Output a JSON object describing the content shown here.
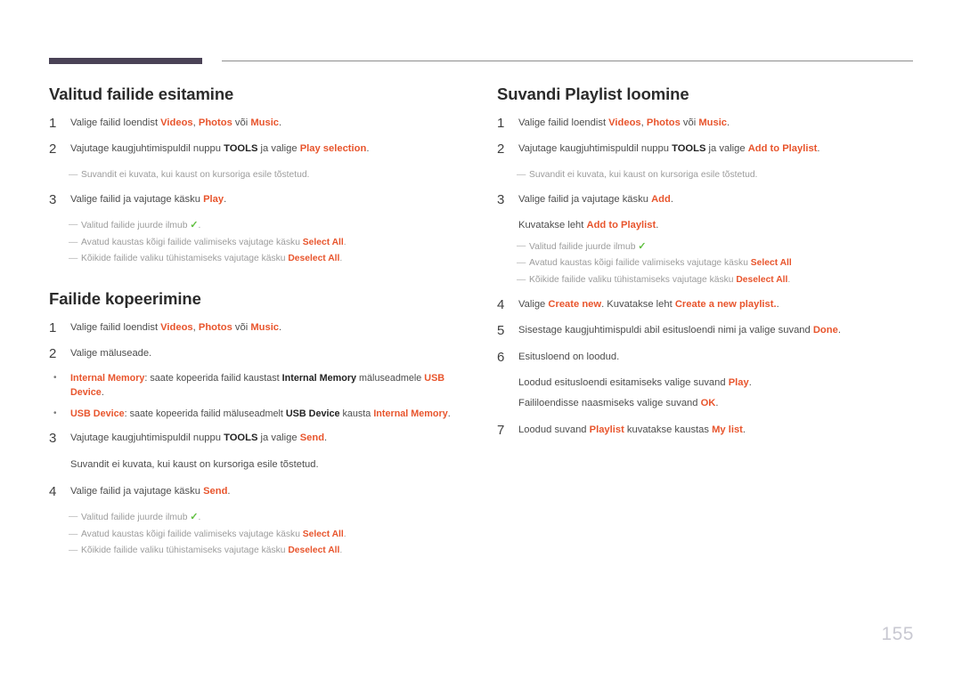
{
  "page": {
    "number": "155",
    "accent_color": "#e8552d",
    "rule_bar_color": "#4a4256",
    "check_color": "#5fbf3f",
    "note_color": "#9c9c9c"
  },
  "left_column": {
    "sections": [
      {
        "title": "Valitud failide esitamine",
        "blocks": [
          {
            "kind": "step",
            "num": "1",
            "parts": [
              {
                "t": "Valige failid loendist ",
                "s": "plain"
              },
              {
                "t": "Videos",
                "s": "em"
              },
              {
                "t": ", ",
                "s": "plain"
              },
              {
                "t": "Photos",
                "s": "em"
              },
              {
                "t": " või ",
                "s": "plain"
              },
              {
                "t": "Music",
                "s": "em"
              },
              {
                "t": ".",
                "s": "plain"
              }
            ]
          },
          {
            "kind": "step",
            "num": "2",
            "parts": [
              {
                "t": "Vajutage kaugjuhtimispuldil nuppu ",
                "s": "plain"
              },
              {
                "t": "TOOLS",
                "s": "key"
              },
              {
                "t": " ja valige ",
                "s": "plain"
              },
              {
                "t": "Play selection",
                "s": "em"
              },
              {
                "t": ".",
                "s": "plain"
              }
            ]
          },
          {
            "kind": "notes",
            "items": [
              {
                "parts": [
                  {
                    "t": "Suvandit ei kuvata, kui kaust on kursoriga esile tõstetud.",
                    "s": "plain"
                  }
                ]
              }
            ]
          },
          {
            "kind": "step",
            "num": "3",
            "parts": [
              {
                "t": "Valige failid ja vajutage käsku ",
                "s": "plain"
              },
              {
                "t": "Play",
                "s": "em"
              },
              {
                "t": ".",
                "s": "plain"
              }
            ]
          },
          {
            "kind": "notes",
            "items": [
              {
                "parts": [
                  {
                    "t": "Valitud failide juurde ilmub ",
                    "s": "plain"
                  },
                  {
                    "t": "✓",
                    "s": "chk"
                  },
                  {
                    "t": ".",
                    "s": "plain"
                  }
                ]
              },
              {
                "parts": [
                  {
                    "t": "Avatud kaustas kõigi failide valimiseks vajutage käsku ",
                    "s": "plain"
                  },
                  {
                    "t": "Select All",
                    "s": "em"
                  },
                  {
                    "t": ".",
                    "s": "plain"
                  }
                ]
              },
              {
                "parts": [
                  {
                    "t": "Kõikide failide valiku tühistamiseks vajutage käsku ",
                    "s": "plain"
                  },
                  {
                    "t": "Deselect All",
                    "s": "em"
                  },
                  {
                    "t": ".",
                    "s": "plain"
                  }
                ]
              }
            ]
          }
        ]
      },
      {
        "title": "Failide kopeerimine",
        "blocks": [
          {
            "kind": "step",
            "num": "1",
            "parts": [
              {
                "t": "Valige failid loendist ",
                "s": "plain"
              },
              {
                "t": "Videos",
                "s": "em"
              },
              {
                "t": ", ",
                "s": "plain"
              },
              {
                "t": "Photos",
                "s": "em"
              },
              {
                "t": " või ",
                "s": "plain"
              },
              {
                "t": "Music",
                "s": "em"
              },
              {
                "t": ".",
                "s": "plain"
              }
            ]
          },
          {
            "kind": "step",
            "num": "2",
            "parts": [
              {
                "t": "Valige mäluseade.",
                "s": "plain"
              }
            ]
          },
          {
            "kind": "bullets",
            "items": [
              {
                "parts": [
                  {
                    "t": "Internal Memory",
                    "s": "em"
                  },
                  {
                    "t": ": saate kopeerida failid kaustast ",
                    "s": "plain"
                  },
                  {
                    "t": "Internal Memory",
                    "s": "key"
                  },
                  {
                    "t": " mäluseadmele ",
                    "s": "plain"
                  },
                  {
                    "t": "USB Device",
                    "s": "em"
                  },
                  {
                    "t": ".",
                    "s": "plain"
                  }
                ]
              },
              {
                "parts": [
                  {
                    "t": "USB Device",
                    "s": "em"
                  },
                  {
                    "t": ": saate kopeerida failid mäluseadmelt ",
                    "s": "plain"
                  },
                  {
                    "t": "USB Device",
                    "s": "key"
                  },
                  {
                    "t": " kausta ",
                    "s": "plain"
                  },
                  {
                    "t": "Internal Memory",
                    "s": "em"
                  },
                  {
                    "t": ".",
                    "s": "plain"
                  }
                ]
              }
            ]
          },
          {
            "kind": "step",
            "num": "3",
            "parts": [
              {
                "t": "Vajutage kaugjuhtimispuldil nuppu ",
                "s": "plain"
              },
              {
                "t": "TOOLS",
                "s": "key"
              },
              {
                "t": " ja valige ",
                "s": "plain"
              },
              {
                "t": "Send",
                "s": "em"
              },
              {
                "t": ".",
                "s": "plain"
              }
            ]
          },
          {
            "kind": "sub",
            "parts": [
              {
                "t": "Suvandit ei kuvata, kui kaust on kursoriga esile tõstetud.",
                "s": "plain"
              }
            ]
          },
          {
            "kind": "step",
            "num": "4",
            "parts": [
              {
                "t": "Valige failid ja vajutage käsku ",
                "s": "plain"
              },
              {
                "t": "Send",
                "s": "em"
              },
              {
                "t": ".",
                "s": "plain"
              }
            ]
          },
          {
            "kind": "notes",
            "items": [
              {
                "parts": [
                  {
                    "t": "Valitud failide juurde ilmub ",
                    "s": "plain"
                  },
                  {
                    "t": "✓",
                    "s": "chk"
                  },
                  {
                    "t": ".",
                    "s": "plain"
                  }
                ]
              },
              {
                "parts": [
                  {
                    "t": "Avatud kaustas kõigi failide valimiseks vajutage käsku ",
                    "s": "plain"
                  },
                  {
                    "t": "Select All",
                    "s": "em"
                  },
                  {
                    "t": ".",
                    "s": "plain"
                  }
                ]
              },
              {
                "parts": [
                  {
                    "t": "Kõikide failide valiku tühistamiseks vajutage käsku ",
                    "s": "plain"
                  },
                  {
                    "t": "Deselect All",
                    "s": "em"
                  },
                  {
                    "t": ".",
                    "s": "plain"
                  }
                ]
              }
            ]
          }
        ]
      }
    ]
  },
  "right_column": {
    "sections": [
      {
        "title": "Suvandi Playlist loomine",
        "blocks": [
          {
            "kind": "step",
            "num": "1",
            "parts": [
              {
                "t": "Valige failid loendist ",
                "s": "plain"
              },
              {
                "t": "Videos",
                "s": "em"
              },
              {
                "t": ", ",
                "s": "plain"
              },
              {
                "t": "Photos",
                "s": "em"
              },
              {
                "t": " või ",
                "s": "plain"
              },
              {
                "t": "Music",
                "s": "em"
              },
              {
                "t": ".",
                "s": "plain"
              }
            ]
          },
          {
            "kind": "step",
            "num": "2",
            "parts": [
              {
                "t": "Vajutage kaugjuhtimispuldil nuppu ",
                "s": "plain"
              },
              {
                "t": "TOOLS",
                "s": "key"
              },
              {
                "t": " ja valige ",
                "s": "plain"
              },
              {
                "t": "Add to Playlist",
                "s": "em"
              },
              {
                "t": ".",
                "s": "plain"
              }
            ]
          },
          {
            "kind": "notes",
            "items": [
              {
                "parts": [
                  {
                    "t": "Suvandit ei kuvata, kui kaust on kursoriga esile tõstetud.",
                    "s": "plain"
                  }
                ]
              }
            ]
          },
          {
            "kind": "step",
            "num": "3",
            "parts": [
              {
                "t": "Valige failid ja vajutage käsku ",
                "s": "plain"
              },
              {
                "t": "Add",
                "s": "em"
              },
              {
                "t": ".",
                "s": "plain"
              }
            ]
          },
          {
            "kind": "sub",
            "tight": true,
            "parts": [
              {
                "t": "Kuvatakse leht ",
                "s": "plain"
              },
              {
                "t": "Add to Playlist",
                "s": "em"
              },
              {
                "t": ".",
                "s": "plain"
              }
            ]
          },
          {
            "kind": "notes",
            "items": [
              {
                "parts": [
                  {
                    "t": "Valitud failide juurde ilmub ",
                    "s": "plain"
                  },
                  {
                    "t": "✓",
                    "s": "chk"
                  }
                ]
              },
              {
                "parts": [
                  {
                    "t": "Avatud kaustas kõigi failide valimiseks vajutage käsku ",
                    "s": "plain"
                  },
                  {
                    "t": "Select All",
                    "s": "em"
                  }
                ]
              },
              {
                "parts": [
                  {
                    "t": "Kõikide failide valiku tühistamiseks vajutage käsku ",
                    "s": "plain"
                  },
                  {
                    "t": "Deselect All",
                    "s": "em"
                  },
                  {
                    "t": ".",
                    "s": "plain"
                  }
                ]
              }
            ]
          },
          {
            "kind": "step",
            "num": "4",
            "parts": [
              {
                "t": "Valige ",
                "s": "plain"
              },
              {
                "t": "Create new",
                "s": "em"
              },
              {
                "t": ". Kuvatakse leht ",
                "s": "plain"
              },
              {
                "t": "Create a new playlist.",
                "s": "em"
              },
              {
                "t": ".",
                "s": "plain"
              }
            ]
          },
          {
            "kind": "step",
            "num": "5",
            "parts": [
              {
                "t": "Sisestage kaugjuhtimispuldi abil esitusloendi nimi ja valige suvand ",
                "s": "plain"
              },
              {
                "t": "Done",
                "s": "em"
              },
              {
                "t": ".",
                "s": "plain"
              }
            ]
          },
          {
            "kind": "step",
            "num": "6",
            "parts": [
              {
                "t": "Esitusloend on loodud.",
                "s": "plain"
              }
            ]
          },
          {
            "kind": "sub",
            "tight": true,
            "parts": [
              {
                "t": "Loodud esitusloendi esitamiseks valige suvand ",
                "s": "plain"
              },
              {
                "t": "Play",
                "s": "em"
              },
              {
                "t": ".",
                "s": "plain"
              }
            ]
          },
          {
            "kind": "sub",
            "parts": [
              {
                "t": "Faililoendisse naasmiseks valige suvand ",
                "s": "plain"
              },
              {
                "t": "OK",
                "s": "em"
              },
              {
                "t": ".",
                "s": "plain"
              }
            ]
          },
          {
            "kind": "step",
            "num": "7",
            "parts": [
              {
                "t": "Loodud suvand ",
                "s": "plain"
              },
              {
                "t": "Playlist",
                "s": "em"
              },
              {
                "t": " kuvatakse kaustas ",
                "s": "plain"
              },
              {
                "t": "My list",
                "s": "em"
              },
              {
                "t": ".",
                "s": "plain"
              }
            ]
          }
        ]
      }
    ]
  }
}
